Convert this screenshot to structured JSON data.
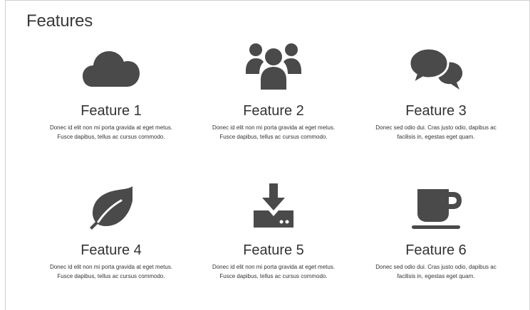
{
  "page": {
    "title": "Features"
  },
  "features": [
    {
      "icon": "cloud-icon",
      "title": "Feature 1",
      "text": "Donec id elit non mi porta gravida at eget metus. Fusce dapibus, tellus ac cursus commodo."
    },
    {
      "icon": "users-icon",
      "title": "Feature 2",
      "text": "Donec id elit non mi porta gravida at eget metus. Fusce dapibus, tellus ac cursus commodo."
    },
    {
      "icon": "chat-bubbles-icon",
      "title": "Feature 3",
      "text": "Donec sed odio dui. Cras justo odio, dapibus ac facilisis in, egestas eget quam."
    },
    {
      "icon": "leaf-icon",
      "title": "Feature 4",
      "text": "Donec id elit non mi porta gravida at eget metus. Fusce dapibus, tellus ac cursus commodo."
    },
    {
      "icon": "download-icon",
      "title": "Feature 5",
      "text": "Donec id elit non mi porta gravida at eget metus. Fusce dapibus, tellus ac cursus commodo."
    },
    {
      "icon": "coffee-cup-icon",
      "title": "Feature 6",
      "text": "Donec sed odio dui. Cras justo odio, dapibus ac facilisis in, egestas eget quam."
    }
  ],
  "colors": {
    "icon": "#4a4a4a",
    "text": "#333333"
  }
}
